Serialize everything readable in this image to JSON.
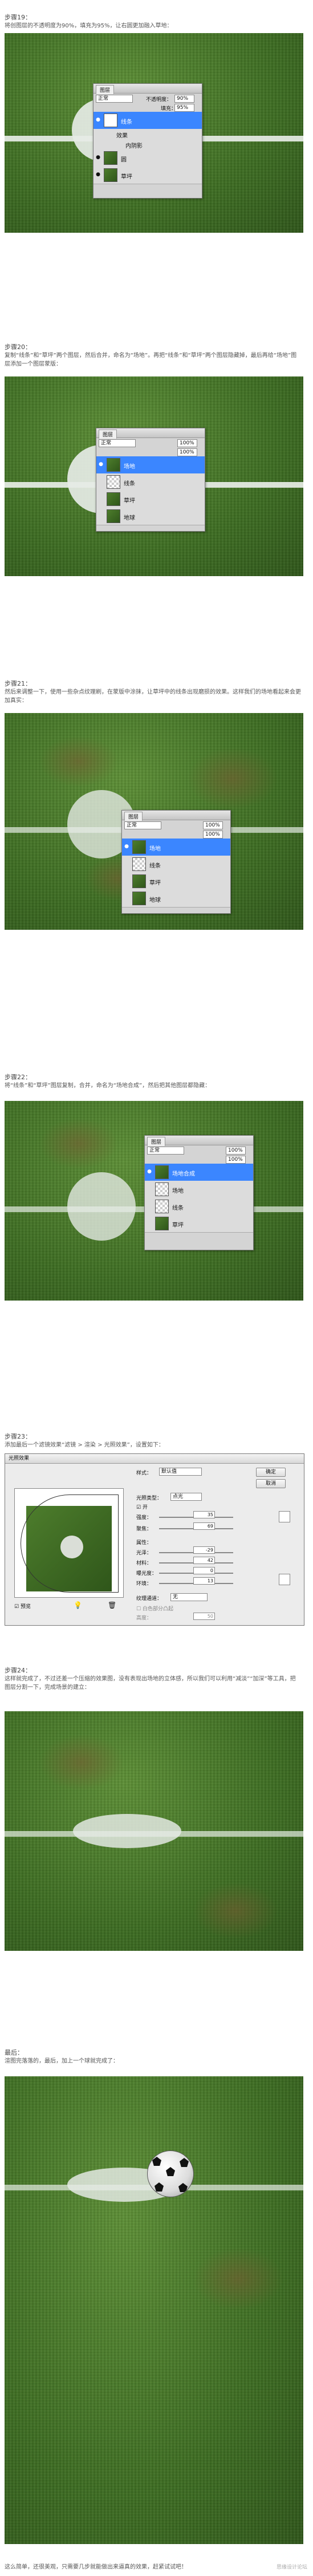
{
  "steps": [
    {
      "label": "步骤19：",
      "desc": "将创图层的不透明度为90%，填充为95%，让右圆更加融入草地：",
      "opacity_label": "不透明度：",
      "opacity": "90%",
      "fill_label": "填充：",
      "fill": "95%",
      "mode": "正常",
      "layers": [
        "线条",
        "效果",
        "内阴影",
        "圆",
        "草坪"
      ]
    },
    {
      "label": "步骤20：",
      "desc": "复制“线条”和“草坪”两个图层，然后合并，命名为“场地”。再把“线条”和“草坪”两个图层隐藏掉，最后再给“场地”图层添加一个图层蒙版：",
      "opacity": "100%",
      "fill": "100%",
      "mode": "正常",
      "layers": [
        "场地",
        "线条",
        "草坪",
        "地球"
      ]
    },
    {
      "label": "步骤21：",
      "desc": "然后来调整一下，使用一些杂点纹理刷，在蒙版中涂抹，让草坪中的线条出现磨损的效果。这样我们的场地看起来会更加真实：",
      "opacity": "100%",
      "fill": "100%",
      "mode": "正常",
      "layers": [
        "场地",
        "线条",
        "草坪",
        "地球"
      ]
    },
    {
      "label": "步骤22：",
      "desc": "将“线条”和“草坪”图层复制，合并，命名为“场地合成”，然后把其他图层都隐藏：",
      "opacity": "100%",
      "fill": "100%",
      "mode": "正常",
      "layers": [
        "场地合成",
        "场地",
        "线条",
        "草坪"
      ]
    },
    {
      "label": "步骤23：",
      "desc": "添加最后一个滤镜效果“滤镜 > 渲染 > 光照效果”，设置如下：",
      "dialog": {
        "title": "光照效果",
        "style_label": "样式：",
        "style_value": "默认值",
        "ok": "确定",
        "cancel": "取消",
        "light_type_label": "光照类型：",
        "light_type": "点光",
        "on_label": "开",
        "intensity_label": "强度：",
        "intensity": "35",
        "focus_label": "聚焦：",
        "focus": "69",
        "properties_label": "属性：",
        "gloss_label": "光泽：",
        "gloss": "-29",
        "material_label": "材料：",
        "material": "42",
        "exposure_label": "曝光度：",
        "exposure": "0",
        "ambience_label": "环境：",
        "ambience": "13",
        "texture_label": "纹理通道：",
        "texture": "无",
        "preview_label": "预览",
        "white_high": "白色部分凸起",
        "height_label": "高度：",
        "height": "50"
      }
    },
    {
      "label": "步骤24：",
      "desc": "这样就完成了，不过还差一个压缩的效果图，没有表现出场地的立体感，所以我们可以利用“减淡”“加深”等工具，把图层分割一下，完成场景的建立：",
      "layers": []
    },
    {
      "label": "最后：",
      "desc": "渲图完落落的，最后，加上一个球就完成了：",
      "layers": []
    }
  ],
  "footer_text": "这么简单，还很美观，只需要几步就能做出来逼真的效果，赶紧试试吧！",
  "watermark": "思缘设计论坛"
}
